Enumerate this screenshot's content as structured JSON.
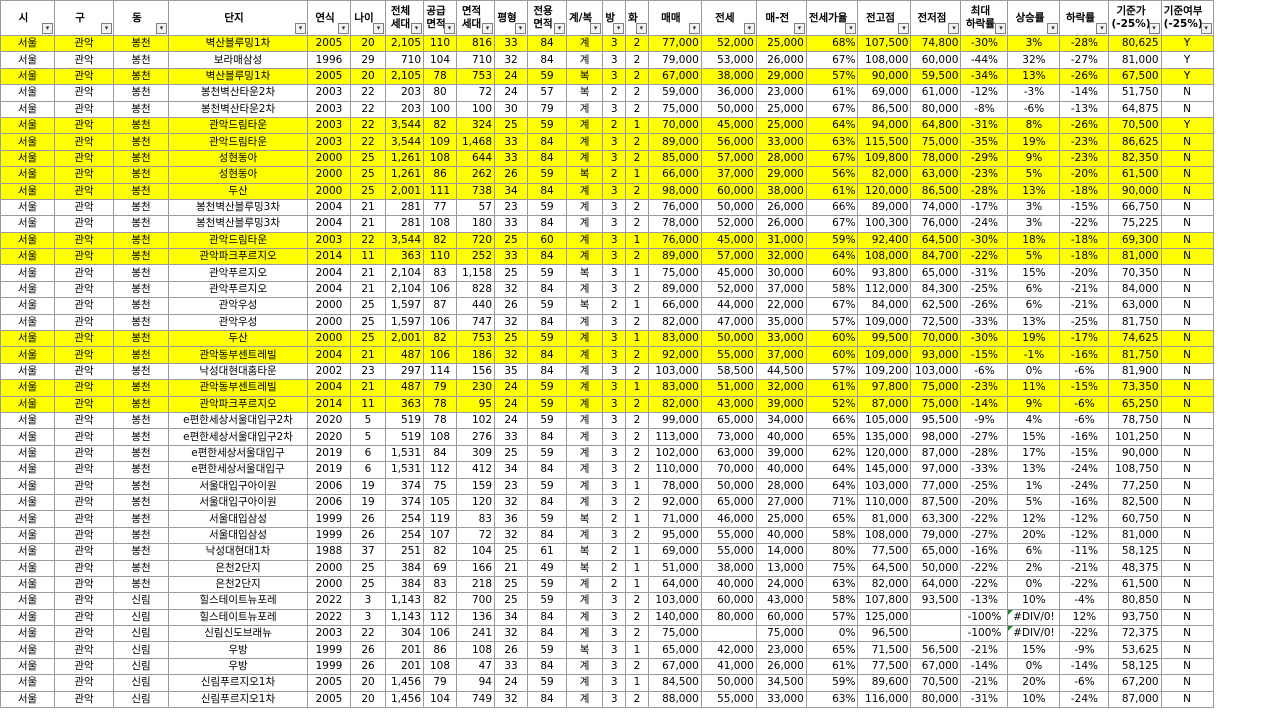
{
  "columns": [
    {
      "label": "시"
    },
    {
      "label": "구"
    },
    {
      "label": "동"
    },
    {
      "label": "단지"
    },
    {
      "label": "연식"
    },
    {
      "label": "나이"
    },
    {
      "label": "전체\n세대"
    },
    {
      "label": "공급\n면적"
    },
    {
      "label": "면적\n세대"
    },
    {
      "label": "평형"
    },
    {
      "label": "전용\n면적"
    },
    {
      "label": "계/복"
    },
    {
      "label": "방"
    },
    {
      "label": "화"
    },
    {
      "label": "매매"
    },
    {
      "label": "전세"
    },
    {
      "label": "매-전"
    },
    {
      "label": "전세가율"
    },
    {
      "label": "전고점"
    },
    {
      "label": "전저점"
    },
    {
      "label": "최대\n하락률"
    },
    {
      "label": "상승률"
    },
    {
      "label": "하락률"
    },
    {
      "label": "기준가\n(-25%)"
    },
    {
      "label": "기준여부\n(-25%)"
    }
  ],
  "rows": [
    {
      "hl": true,
      "cells": [
        "서울",
        "관악",
        "봉천",
        "벽산블루밍1차",
        "2005",
        "20",
        "2,105",
        "110",
        "816",
        "33",
        "84",
        "계",
        "3",
        "2",
        "77,000",
        "52,000",
        "25,000",
        "68%",
        "107,500",
        "74,800",
        "-30%",
        "3%",
        "-28%",
        "80,625",
        "Y"
      ]
    },
    {
      "hl": false,
      "cells": [
        "서울",
        "관악",
        "봉천",
        "보라매삼성",
        "1996",
        "29",
        "710",
        "104",
        "710",
        "32",
        "84",
        "계",
        "3",
        "2",
        "79,000",
        "53,000",
        "26,000",
        "67%",
        "108,000",
        "60,000",
        "-44%",
        "32%",
        "-27%",
        "81,000",
        "Y"
      ]
    },
    {
      "hl": true,
      "cells": [
        "서울",
        "관악",
        "봉천",
        "벽산블루밍1차",
        "2005",
        "20",
        "2,105",
        "78",
        "753",
        "24",
        "59",
        "복",
        "3",
        "2",
        "67,000",
        "38,000",
        "29,000",
        "57%",
        "90,000",
        "59,500",
        "-34%",
        "13%",
        "-26%",
        "67,500",
        "Y"
      ]
    },
    {
      "hl": false,
      "cells": [
        "서울",
        "관악",
        "봉천",
        "봉천벽산타운2차",
        "2003",
        "22",
        "203",
        "80",
        "72",
        "24",
        "57",
        "복",
        "2",
        "2",
        "59,000",
        "36,000",
        "23,000",
        "61%",
        "69,000",
        "61,000",
        "-12%",
        "-3%",
        "-14%",
        "51,750",
        "N"
      ]
    },
    {
      "hl": false,
      "cells": [
        "서울",
        "관악",
        "봉천",
        "봉천벽산타운2차",
        "2003",
        "22",
        "203",
        "100",
        "100",
        "30",
        "79",
        "계",
        "3",
        "2",
        "75,000",
        "50,000",
        "25,000",
        "67%",
        "86,500",
        "80,000",
        "-8%",
        "-6%",
        "-13%",
        "64,875",
        "N"
      ]
    },
    {
      "hl": true,
      "cells": [
        "서울",
        "관악",
        "봉천",
        "관악드림타운",
        "2003",
        "22",
        "3,544",
        "82",
        "324",
        "25",
        "59",
        "계",
        "2",
        "1",
        "70,000",
        "45,000",
        "25,000",
        "64%",
        "94,000",
        "64,800",
        "-31%",
        "8%",
        "-26%",
        "70,500",
        "Y"
      ]
    },
    {
      "hl": true,
      "cells": [
        "서울",
        "관악",
        "봉천",
        "관악드림타운",
        "2003",
        "22",
        "3,544",
        "109",
        "1,468",
        "33",
        "84",
        "계",
        "3",
        "2",
        "89,000",
        "56,000",
        "33,000",
        "63%",
        "115,500",
        "75,000",
        "-35%",
        "19%",
        "-23%",
        "86,625",
        "N"
      ]
    },
    {
      "hl": true,
      "cells": [
        "서울",
        "관악",
        "봉천",
        "성현동아",
        "2000",
        "25",
        "1,261",
        "108",
        "644",
        "33",
        "84",
        "계",
        "3",
        "2",
        "85,000",
        "57,000",
        "28,000",
        "67%",
        "109,800",
        "78,000",
        "-29%",
        "9%",
        "-23%",
        "82,350",
        "N"
      ]
    },
    {
      "hl": true,
      "cells": [
        "서울",
        "관악",
        "봉천",
        "성현동아",
        "2000",
        "25",
        "1,261",
        "86",
        "262",
        "26",
        "59",
        "복",
        "2",
        "1",
        "66,000",
        "37,000",
        "29,000",
        "56%",
        "82,000",
        "63,000",
        "-23%",
        "5%",
        "-20%",
        "61,500",
        "N"
      ]
    },
    {
      "hl": true,
      "cells": [
        "서울",
        "관악",
        "봉천",
        "두산",
        "2000",
        "25",
        "2,001",
        "111",
        "738",
        "34",
        "84",
        "계",
        "3",
        "2",
        "98,000",
        "60,000",
        "38,000",
        "61%",
        "120,000",
        "86,500",
        "-28%",
        "13%",
        "-18%",
        "90,000",
        "N"
      ]
    },
    {
      "hl": false,
      "cells": [
        "서울",
        "관악",
        "봉천",
        "봉천벽산블루밍3차",
        "2004",
        "21",
        "281",
        "77",
        "57",
        "23",
        "59",
        "계",
        "3",
        "2",
        "76,000",
        "50,000",
        "26,000",
        "66%",
        "89,000",
        "74,000",
        "-17%",
        "3%",
        "-15%",
        "66,750",
        "N"
      ]
    },
    {
      "hl": false,
      "cells": [
        "서울",
        "관악",
        "봉천",
        "봉천벽산블루밍3차",
        "2004",
        "21",
        "281",
        "108",
        "180",
        "33",
        "84",
        "계",
        "3",
        "2",
        "78,000",
        "52,000",
        "26,000",
        "67%",
        "100,300",
        "76,000",
        "-24%",
        "3%",
        "-22%",
        "75,225",
        "N"
      ]
    },
    {
      "hl": true,
      "cells": [
        "서울",
        "관악",
        "봉천",
        "관악드림타운",
        "2003",
        "22",
        "3,544",
        "82",
        "720",
        "25",
        "60",
        "계",
        "3",
        "1",
        "76,000",
        "45,000",
        "31,000",
        "59%",
        "92,400",
        "64,500",
        "-30%",
        "18%",
        "-18%",
        "69,300",
        "N"
      ]
    },
    {
      "hl": true,
      "cells": [
        "서울",
        "관악",
        "봉천",
        "관악파크푸르지오",
        "2014",
        "11",
        "363",
        "110",
        "252",
        "33",
        "84",
        "계",
        "3",
        "2",
        "89,000",
        "57,000",
        "32,000",
        "64%",
        "108,000",
        "84,700",
        "-22%",
        "5%",
        "-18%",
        "81,000",
        "N"
      ]
    },
    {
      "hl": false,
      "cells": [
        "서울",
        "관악",
        "봉천",
        "관악푸르지오",
        "2004",
        "21",
        "2,104",
        "83",
        "1,158",
        "25",
        "59",
        "복",
        "3",
        "1",
        "75,000",
        "45,000",
        "30,000",
        "60%",
        "93,800",
        "65,000",
        "-31%",
        "15%",
        "-20%",
        "70,350",
        "N"
      ]
    },
    {
      "hl": false,
      "cells": [
        "서울",
        "관악",
        "봉천",
        "관악푸르지오",
        "2004",
        "21",
        "2,104",
        "106",
        "828",
        "32",
        "84",
        "계",
        "3",
        "2",
        "89,000",
        "52,000",
        "37,000",
        "58%",
        "112,000",
        "84,300",
        "-25%",
        "6%",
        "-21%",
        "84,000",
        "N"
      ]
    },
    {
      "hl": false,
      "cells": [
        "서울",
        "관악",
        "봉천",
        "관악우성",
        "2000",
        "25",
        "1,597",
        "87",
        "440",
        "26",
        "59",
        "복",
        "2",
        "1",
        "66,000",
        "44,000",
        "22,000",
        "67%",
        "84,000",
        "62,500",
        "-26%",
        "6%",
        "-21%",
        "63,000",
        "N"
      ]
    },
    {
      "hl": false,
      "cells": [
        "서울",
        "관악",
        "봉천",
        "관악우성",
        "2000",
        "25",
        "1,597",
        "106",
        "747",
        "32",
        "84",
        "계",
        "3",
        "2",
        "82,000",
        "47,000",
        "35,000",
        "57%",
        "109,000",
        "72,500",
        "-33%",
        "13%",
        "-25%",
        "81,750",
        "N"
      ]
    },
    {
      "hl": true,
      "cells": [
        "서울",
        "관악",
        "봉천",
        "두산",
        "2000",
        "25",
        "2,001",
        "82",
        "753",
        "25",
        "59",
        "계",
        "3",
        "1",
        "83,000",
        "50,000",
        "33,000",
        "60%",
        "99,500",
        "70,000",
        "-30%",
        "19%",
        "-17%",
        "74,625",
        "N"
      ]
    },
    {
      "hl": true,
      "cells": [
        "서울",
        "관악",
        "봉천",
        "관악동부센트레빌",
        "2004",
        "21",
        "487",
        "106",
        "186",
        "32",
        "84",
        "계",
        "3",
        "2",
        "92,000",
        "55,000",
        "37,000",
        "60%",
        "109,000",
        "93,000",
        "-15%",
        "-1%",
        "-16%",
        "81,750",
        "N"
      ]
    },
    {
      "hl": false,
      "cells": [
        "서울",
        "관악",
        "봉천",
        "낙성대현대홈타운",
        "2002",
        "23",
        "297",
        "114",
        "156",
        "35",
        "84",
        "계",
        "3",
        "2",
        "103,000",
        "58,500",
        "44,500",
        "57%",
        "109,200",
        "103,000",
        "-6%",
        "0%",
        "-6%",
        "81,900",
        "N"
      ]
    },
    {
      "hl": true,
      "cells": [
        "서울",
        "관악",
        "봉천",
        "관악동부센트레빌",
        "2004",
        "21",
        "487",
        "79",
        "230",
        "24",
        "59",
        "계",
        "3",
        "1",
        "83,000",
        "51,000",
        "32,000",
        "61%",
        "97,800",
        "75,000",
        "-23%",
        "11%",
        "-15%",
        "73,350",
        "N"
      ]
    },
    {
      "hl": true,
      "cells": [
        "서울",
        "관악",
        "봉천",
        "관악파크푸르지오",
        "2014",
        "11",
        "363",
        "78",
        "95",
        "24",
        "59",
        "계",
        "3",
        "2",
        "82,000",
        "43,000",
        "39,000",
        "52%",
        "87,000",
        "75,000",
        "-14%",
        "9%",
        "-6%",
        "65,250",
        "N"
      ]
    },
    {
      "hl": false,
      "cells": [
        "서울",
        "관악",
        "봉천",
        "e편한세상서울대입구2차",
        "2020",
        "5",
        "519",
        "78",
        "102",
        "24",
        "59",
        "계",
        "3",
        "2",
        "99,000",
        "65,000",
        "34,000",
        "66%",
        "105,000",
        "95,500",
        "-9%",
        "4%",
        "-6%",
        "78,750",
        "N"
      ]
    },
    {
      "hl": false,
      "cells": [
        "서울",
        "관악",
        "봉천",
        "e편한세상서울대입구2차",
        "2020",
        "5",
        "519",
        "108",
        "276",
        "33",
        "84",
        "계",
        "3",
        "2",
        "113,000",
        "73,000",
        "40,000",
        "65%",
        "135,000",
        "98,000",
        "-27%",
        "15%",
        "-16%",
        "101,250",
        "N"
      ]
    },
    {
      "hl": false,
      "cells": [
        "서울",
        "관악",
        "봉천",
        "e편한세상서울대입구",
        "2019",
        "6",
        "1,531",
        "84",
        "309",
        "25",
        "59",
        "계",
        "3",
        "2",
        "102,000",
        "63,000",
        "39,000",
        "62%",
        "120,000",
        "87,000",
        "-28%",
        "17%",
        "-15%",
        "90,000",
        "N"
      ]
    },
    {
      "hl": false,
      "cells": [
        "서울",
        "관악",
        "봉천",
        "e편한세상서울대입구",
        "2019",
        "6",
        "1,531",
        "112",
        "412",
        "34",
        "84",
        "계",
        "3",
        "2",
        "110,000",
        "70,000",
        "40,000",
        "64%",
        "145,000",
        "97,000",
        "-33%",
        "13%",
        "-24%",
        "108,750",
        "N"
      ]
    },
    {
      "hl": false,
      "cells": [
        "서울",
        "관악",
        "봉천",
        "서울대입구아이원",
        "2006",
        "19",
        "374",
        "75",
        "159",
        "23",
        "59",
        "계",
        "3",
        "1",
        "78,000",
        "50,000",
        "28,000",
        "64%",
        "103,000",
        "77,000",
        "-25%",
        "1%",
        "-24%",
        "77,250",
        "N"
      ]
    },
    {
      "hl": false,
      "cells": [
        "서울",
        "관악",
        "봉천",
        "서울대입구아이원",
        "2006",
        "19",
        "374",
        "105",
        "120",
        "32",
        "84",
        "계",
        "3",
        "2",
        "92,000",
        "65,000",
        "27,000",
        "71%",
        "110,000",
        "87,500",
        "-20%",
        "5%",
        "-16%",
        "82,500",
        "N"
      ]
    },
    {
      "hl": false,
      "cells": [
        "서울",
        "관악",
        "봉천",
        "서울대입삼성",
        "1999",
        "26",
        "254",
        "119",
        "83",
        "36",
        "59",
        "복",
        "2",
        "1",
        "71,000",
        "46,000",
        "25,000",
        "65%",
        "81,000",
        "63,300",
        "-22%",
        "12%",
        "-12%",
        "60,750",
        "N"
      ]
    },
    {
      "hl": false,
      "cells": [
        "서울",
        "관악",
        "봉천",
        "서울대입삼성",
        "1999",
        "26",
        "254",
        "107",
        "72",
        "32",
        "84",
        "계",
        "3",
        "2",
        "95,000",
        "55,000",
        "40,000",
        "58%",
        "108,000",
        "79,000",
        "-27%",
        "20%",
        "-12%",
        "81,000",
        "N"
      ]
    },
    {
      "hl": false,
      "cells": [
        "서울",
        "관악",
        "봉천",
        "낙성대현대1차",
        "1988",
        "37",
        "251",
        "82",
        "104",
        "25",
        "61",
        "복",
        "2",
        "1",
        "69,000",
        "55,000",
        "14,000",
        "80%",
        "77,500",
        "65,000",
        "-16%",
        "6%",
        "-11%",
        "58,125",
        "N"
      ]
    },
    {
      "hl": false,
      "cells": [
        "서울",
        "관악",
        "봉천",
        "은천2단지",
        "2000",
        "25",
        "384",
        "69",
        "166",
        "21",
        "49",
        "복",
        "2",
        "1",
        "51,000",
        "38,000",
        "13,000",
        "75%",
        "64,500",
        "50,000",
        "-22%",
        "2%",
        "-21%",
        "48,375",
        "N"
      ]
    },
    {
      "hl": false,
      "cells": [
        "서울",
        "관악",
        "봉천",
        "은천2단지",
        "2000",
        "25",
        "384",
        "83",
        "218",
        "25",
        "59",
        "계",
        "2",
        "1",
        "64,000",
        "40,000",
        "24,000",
        "63%",
        "82,000",
        "64,000",
        "-22%",
        "0%",
        "-22%",
        "61,500",
        "N"
      ]
    },
    {
      "hl": false,
      "cells": [
        "서울",
        "관악",
        "신림",
        "힐스테이트뉴포레",
        "2022",
        "3",
        "1,143",
        "82",
        "700",
        "25",
        "59",
        "계",
        "3",
        "2",
        "103,000",
        "60,000",
        "43,000",
        "58%",
        "107,800",
        "93,500",
        "-13%",
        "10%",
        "-4%",
        "80,850",
        "N"
      ]
    },
    {
      "hl": false,
      "cells": [
        "서울",
        "관악",
        "신림",
        "힐스테이트뉴포레",
        "2022",
        "3",
        "1,143",
        "112",
        "136",
        "34",
        "84",
        "계",
        "3",
        "2",
        "140,000",
        "80,000",
        "60,000",
        "57%",
        "125,000",
        "",
        "-100%",
        "#DIV/0!",
        "12%",
        "93,750",
        "N"
      ]
    },
    {
      "hl": false,
      "cells": [
        "서울",
        "관악",
        "신림",
        "신림신도브래뉴",
        "2003",
        "22",
        "304",
        "106",
        "241",
        "32",
        "84",
        "계",
        "3",
        "2",
        "75,000",
        "",
        "75,000",
        "0%",
        "96,500",
        "",
        "-100%",
        "#DIV/0!",
        "-22%",
        "72,375",
        "N"
      ]
    },
    {
      "hl": false,
      "cells": [
        "서울",
        "관악",
        "신림",
        "우방",
        "1999",
        "26",
        "201",
        "86",
        "108",
        "26",
        "59",
        "복",
        "3",
        "1",
        "65,000",
        "42,000",
        "23,000",
        "65%",
        "71,500",
        "56,500",
        "-21%",
        "15%",
        "-9%",
        "53,625",
        "N"
      ]
    },
    {
      "hl": false,
      "cells": [
        "서울",
        "관악",
        "신림",
        "우방",
        "1999",
        "26",
        "201",
        "108",
        "47",
        "33",
        "84",
        "계",
        "3",
        "2",
        "67,000",
        "41,000",
        "26,000",
        "61%",
        "77,500",
        "67,000",
        "-14%",
        "0%",
        "-14%",
        "58,125",
        "N"
      ]
    },
    {
      "hl": false,
      "cells": [
        "서울",
        "관악",
        "신림",
        "신림푸르지오1차",
        "2005",
        "20",
        "1,456",
        "79",
        "94",
        "24",
        "59",
        "계",
        "3",
        "1",
        "84,500",
        "50,000",
        "34,500",
        "59%",
        "89,600",
        "70,500",
        "-21%",
        "20%",
        "-6%",
        "67,200",
        "N"
      ]
    },
    {
      "hl": false,
      "cells": [
        "서울",
        "관악",
        "신림",
        "신림푸르지오1차",
        "2005",
        "20",
        "1,456",
        "104",
        "749",
        "32",
        "84",
        "계",
        "3",
        "2",
        "88,000",
        "55,000",
        "33,000",
        "63%",
        "116,000",
        "80,000",
        "-31%",
        "10%",
        "-24%",
        "87,000",
        "N"
      ]
    }
  ]
}
